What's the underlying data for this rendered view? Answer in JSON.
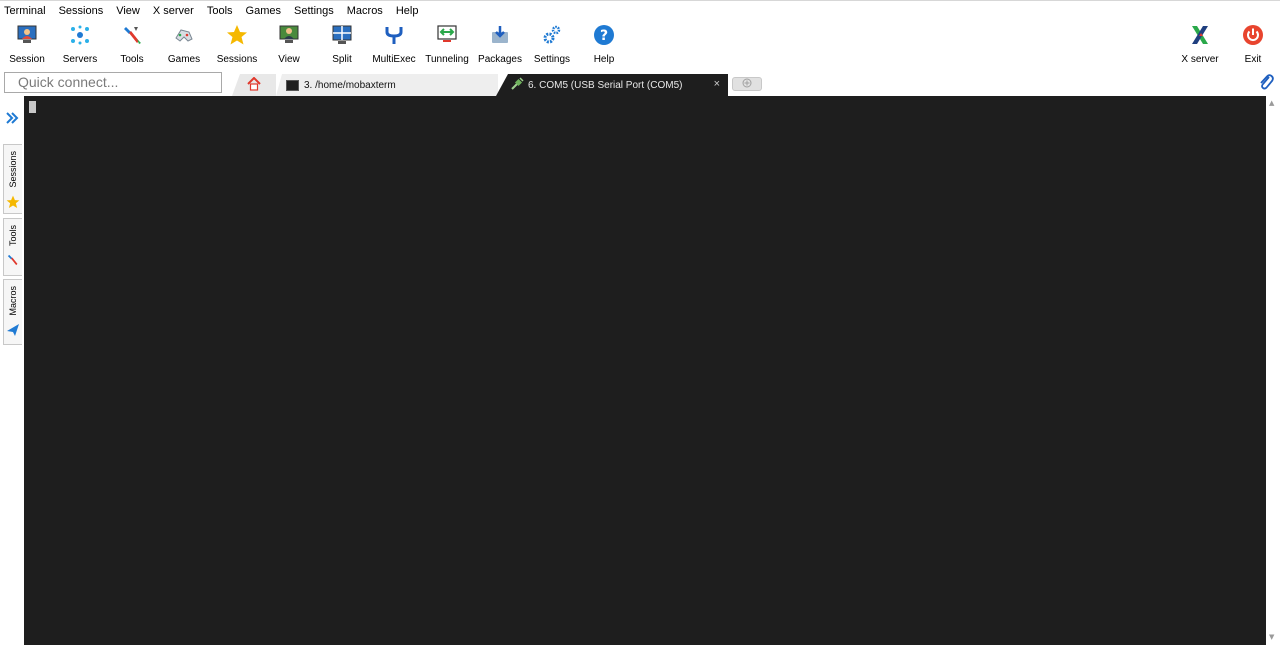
{
  "menu": [
    "Terminal",
    "Sessions",
    "View",
    "X server",
    "Tools",
    "Games",
    "Settings",
    "Macros",
    "Help"
  ],
  "toolbar": {
    "session": "Session",
    "servers": "Servers",
    "tools": "Tools",
    "games": "Games",
    "sessions": "Sessions",
    "view": "View",
    "split": "Split",
    "multiexec": "MultiExec",
    "tunneling": "Tunneling",
    "packages": "Packages",
    "settings": "Settings",
    "help": "Help",
    "xserver": "X server",
    "exit": "Exit"
  },
  "quick_connect": {
    "placeholder": "Quick connect..."
  },
  "tabs": {
    "terminal": "3. /home/mobaxterm",
    "com": "6. COM5  (USB Serial Port (COM5)",
    "close": "×"
  },
  "sidebar": {
    "sessions": "Sessions",
    "tools": "Tools",
    "macros": "Macros"
  },
  "colors": {
    "accent": "#1f7ad3",
    "terminal_bg": "#1e1e1e",
    "star": "#f5b800",
    "exit_red": "#e8442e"
  }
}
